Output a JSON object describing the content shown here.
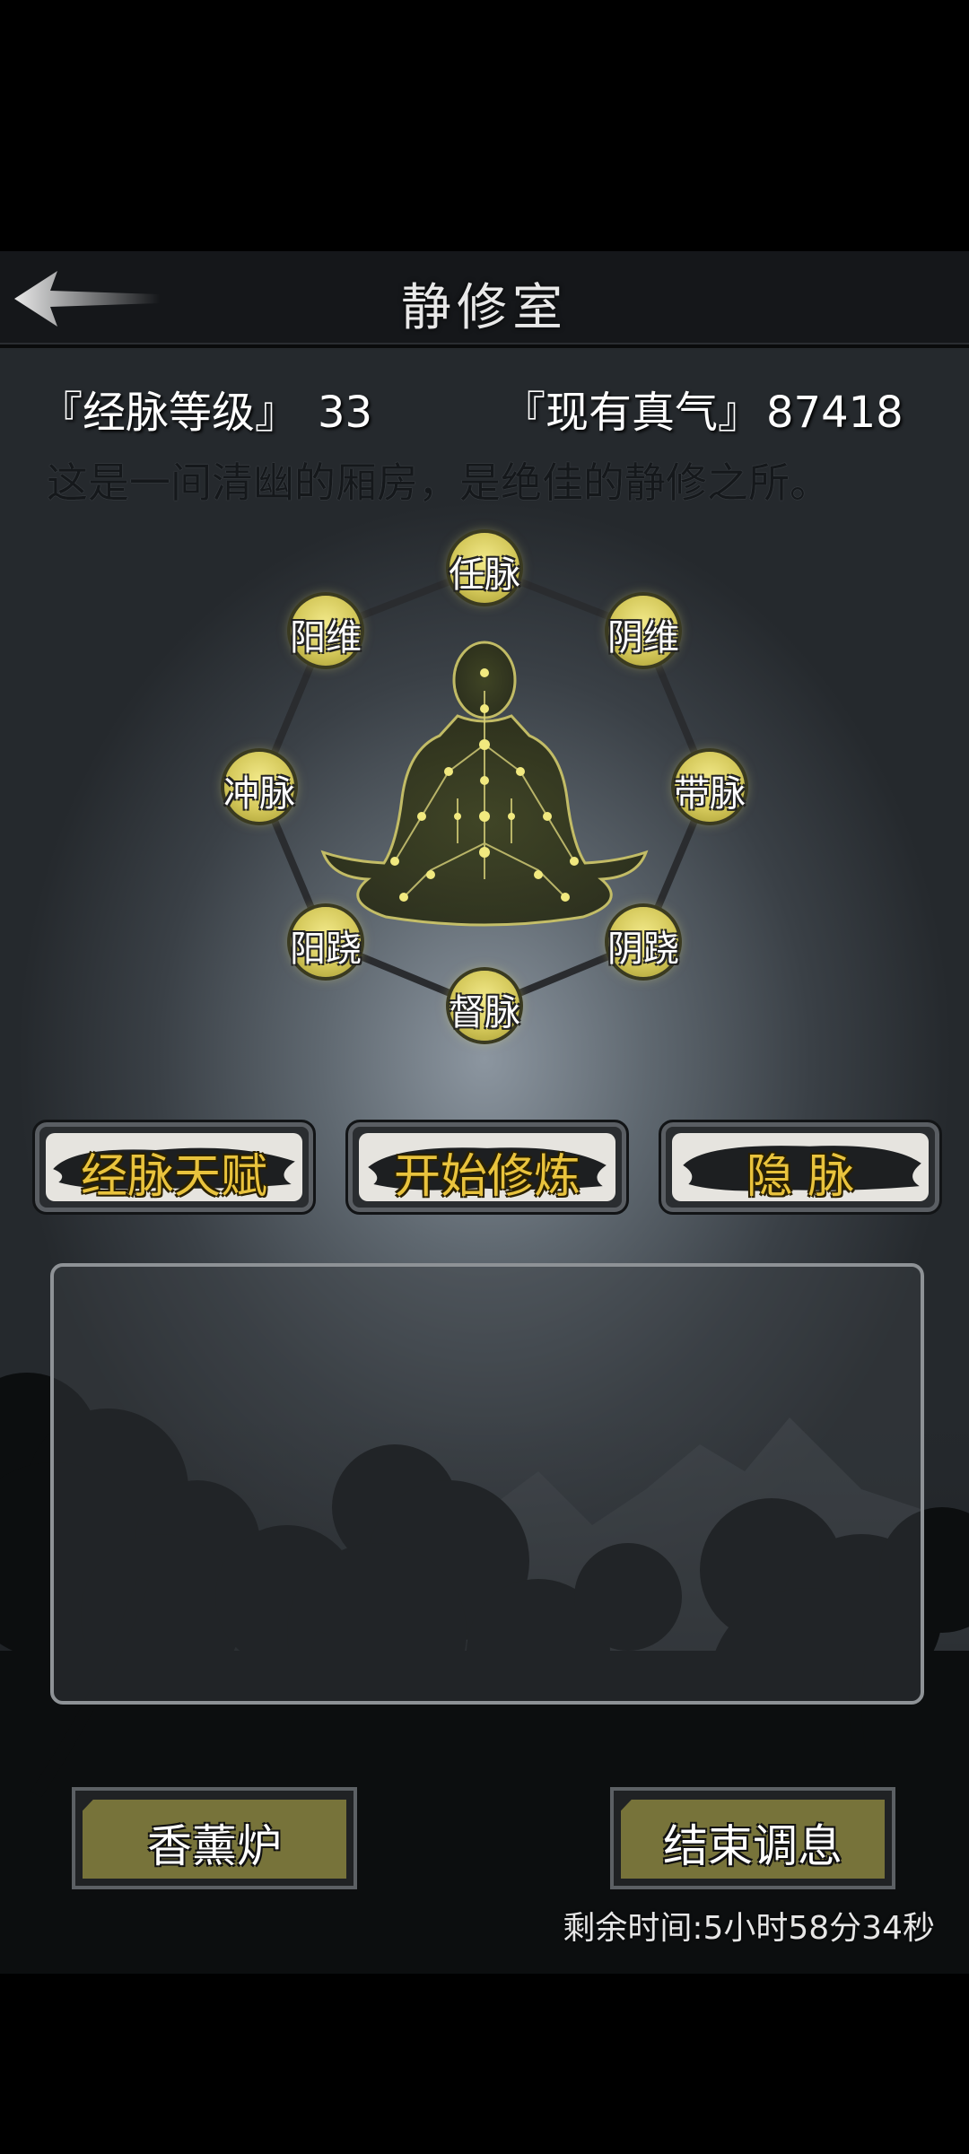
{
  "header": {
    "title": "静修室"
  },
  "stats": {
    "meridian_label": "『经脉等级』",
    "meridian_value": "33",
    "qi_label": "『现有真气』",
    "qi_value": "87418"
  },
  "description": "这是一间清幽的厢房，是绝佳的静修之所。",
  "meridians": {
    "ren": "任脉",
    "yang_wei": "阳维",
    "yin_wei": "阴维",
    "chong": "冲脉",
    "dai": "带脉",
    "yang_qiao": "阳跷",
    "yin_qiao": "阴跷",
    "du": "督脉"
  },
  "actions": {
    "talent": "经脉天赋",
    "start_cultivate": "开始修炼",
    "hide_meridian": "隐 脉"
  },
  "bottom": {
    "incense": "香薰炉",
    "end_rest": "结束调息",
    "remaining_time": "剩余时间:5小时58分34秒"
  },
  "colors": {
    "accent_gold": "#e9c33d",
    "node_yellow": "#d4c85a",
    "olive": "#77733a"
  }
}
